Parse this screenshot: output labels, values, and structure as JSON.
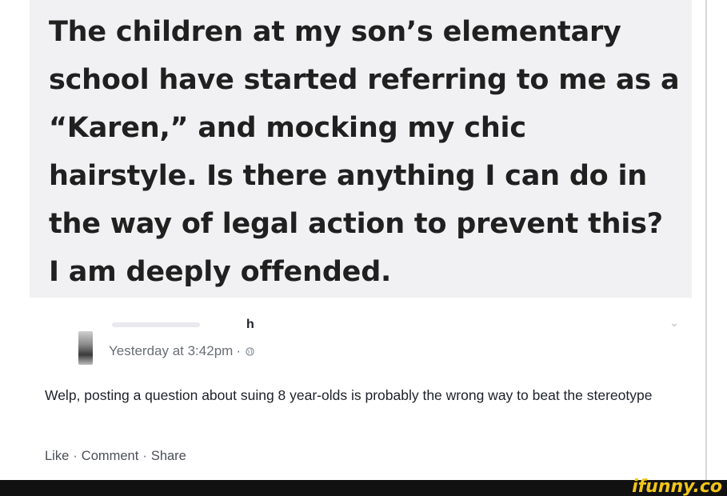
{
  "question": {
    "text": "The children at my son’s elementary school have started referring to me as a “Karen,” and mocking my chic hairstyle. Is there anything I can do in the way of legal action to prevent this? I am deeply offended."
  },
  "post": {
    "author_visible": "h",
    "timestamp": "Yesterday at 3:42pm",
    "separator": "·",
    "privacy_icon": "globe-icon",
    "options_icon": "chevron-down-icon",
    "comment": "Welp, posting a question about suing 8 year-olds is probably the wrong way to beat the stereotype",
    "actions": [
      "Like",
      "Comment",
      "Share"
    ]
  },
  "watermark": "ifunny.co",
  "colors": {
    "quote_bg": "#f1f1f3",
    "watermark": "#f0c419",
    "footer": "#111111"
  }
}
